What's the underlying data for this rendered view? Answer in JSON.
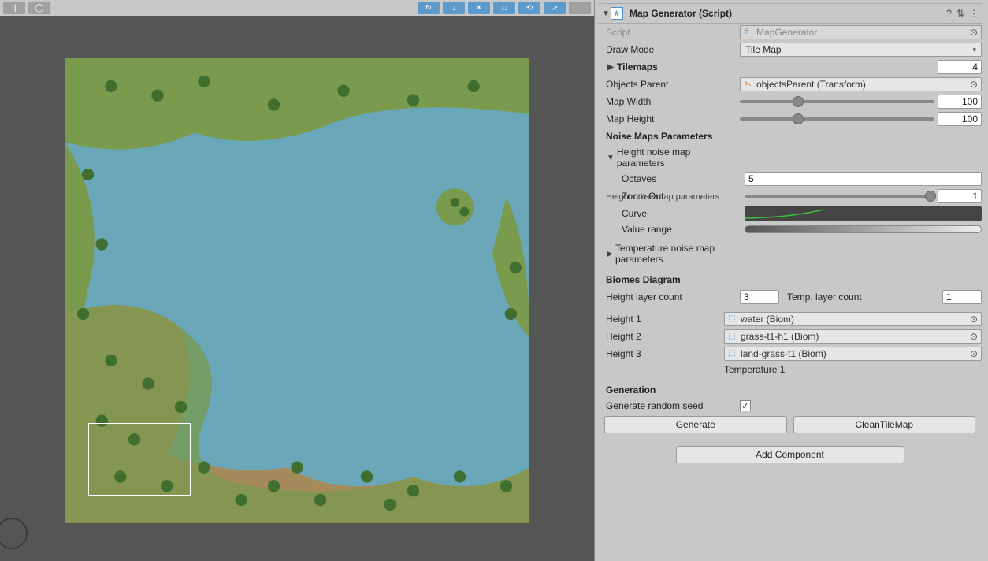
{
  "viewport": {
    "selection_label": ""
  },
  "inspector": {
    "component_title": "Map Generator (Script)",
    "script": {
      "label": "Script",
      "value": "MapGenerator"
    },
    "drawmode": {
      "label": "Draw Mode",
      "value": "Tile Map"
    },
    "tilemaps": {
      "label": "Tilemaps",
      "value": "4"
    },
    "objects_parent": {
      "label": "Objects Parent",
      "value": "objectsParent (Transform)"
    },
    "map_width": {
      "label": "Map Width",
      "value": "100"
    },
    "map_height": {
      "label": "Map Height",
      "value": "100"
    },
    "noise_header": "Noise Maps Parameters",
    "height_noise_header": "Height noise map parameters",
    "octaves": {
      "label": "Octaves",
      "value": "5"
    },
    "zoom_out": {
      "label": "Zoom Out",
      "value": "1"
    },
    "overlap_text": "Height noise map parameters",
    "curve_label": "Curve",
    "value_range_label": "Value range",
    "temp_noise_header": "Temperature noise map parameters",
    "biomes_header": "Biomes Diagram",
    "height_layer_count": {
      "label": "Height layer count",
      "value": "3"
    },
    "temp_layer_count": {
      "label": "Temp. layer count",
      "value": "1"
    },
    "heights": [
      {
        "label": "Height 1",
        "value": "water (Biom)"
      },
      {
        "label": "Height 2",
        "value": "grass-t1-h1 (Biom)"
      },
      {
        "label": "Height 3",
        "value": "land-grass-t1 (Biom)"
      }
    ],
    "temperature_row": "Temperature 1",
    "generation_header": "Generation",
    "random_seed": {
      "label": "Generate random seed",
      "checked": "✓"
    },
    "generate_btn": "Generate",
    "clean_btn": "CleanTileMap",
    "add_component": "Add Component"
  }
}
